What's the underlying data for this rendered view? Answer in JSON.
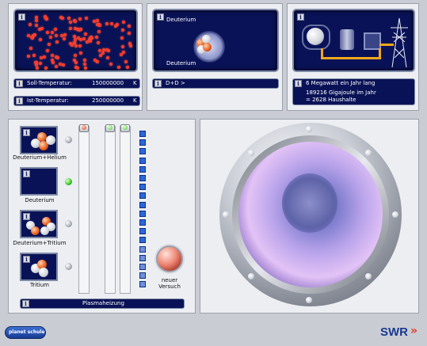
{
  "panels": {
    "temperature": {
      "soll_label": "Soll-Temperatur:",
      "soll_value": "150000000",
      "soll_unit": "K",
      "ist_label": "Ist-Temperatur:",
      "ist_value": "250000000",
      "ist_unit": "K"
    },
    "reaction": {
      "top_label": "Deuterium",
      "bottom_label": "Deuterium",
      "equation": "D+D >"
    },
    "energy": {
      "line1": "6 Megawatt ein Jahr lang",
      "line2": "189216 Gigajoule im Jahr",
      "line3": "= 2628 Haushalte"
    }
  },
  "fuel_options": [
    {
      "label": "Deuterium+Helium",
      "selected": false
    },
    {
      "label": "Deuterium",
      "selected": true
    },
    {
      "label": "Deuterium+Tritium",
      "selected": false
    },
    {
      "label": "Tritium",
      "selected": false
    }
  ],
  "controls": {
    "reset_label_line1": "neuer",
    "reset_label_line2": "Versuch",
    "heating_label": "Plasmaheizung",
    "info_glyph": "i"
  },
  "footer": {
    "logo_left": "planet schule",
    "logo_right": "SWR"
  },
  "colors": {
    "screen_bg": "#0a1257",
    "panel_bg": "#eceef2",
    "plasma_dot": "#ff3a2a",
    "led_on": "#3ecb2a",
    "meter_square": "#2d67d8"
  }
}
